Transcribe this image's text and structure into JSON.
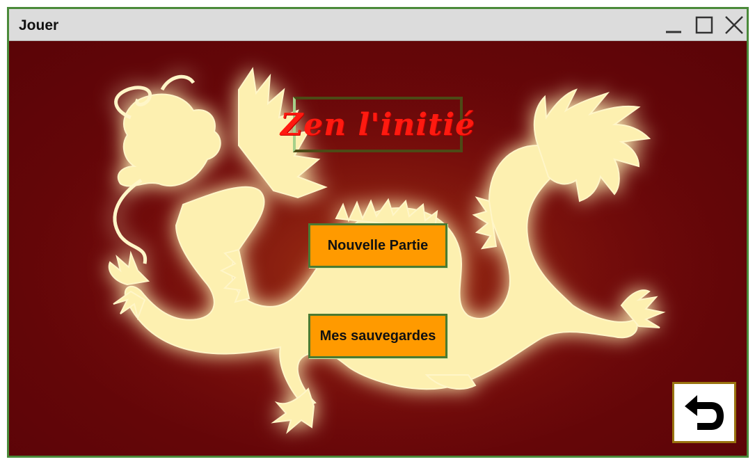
{
  "window": {
    "title": "Jouer",
    "controls": {
      "minimize": "minimize-icon",
      "maximize": "maximize-icon",
      "close": "close-icon"
    }
  },
  "game": {
    "title": "Zen l'initié"
  },
  "menu": {
    "new_game_label": "Nouvelle Partie",
    "saves_label": "Mes sauvegardes"
  },
  "back_button": {
    "icon": "return-arrow-icon"
  },
  "colors": {
    "background": "#5d0508",
    "dragon": "#fdf0b0",
    "button": "#ff9a00",
    "title_text": "#ff1a10",
    "window_border": "#4a8a3a"
  }
}
